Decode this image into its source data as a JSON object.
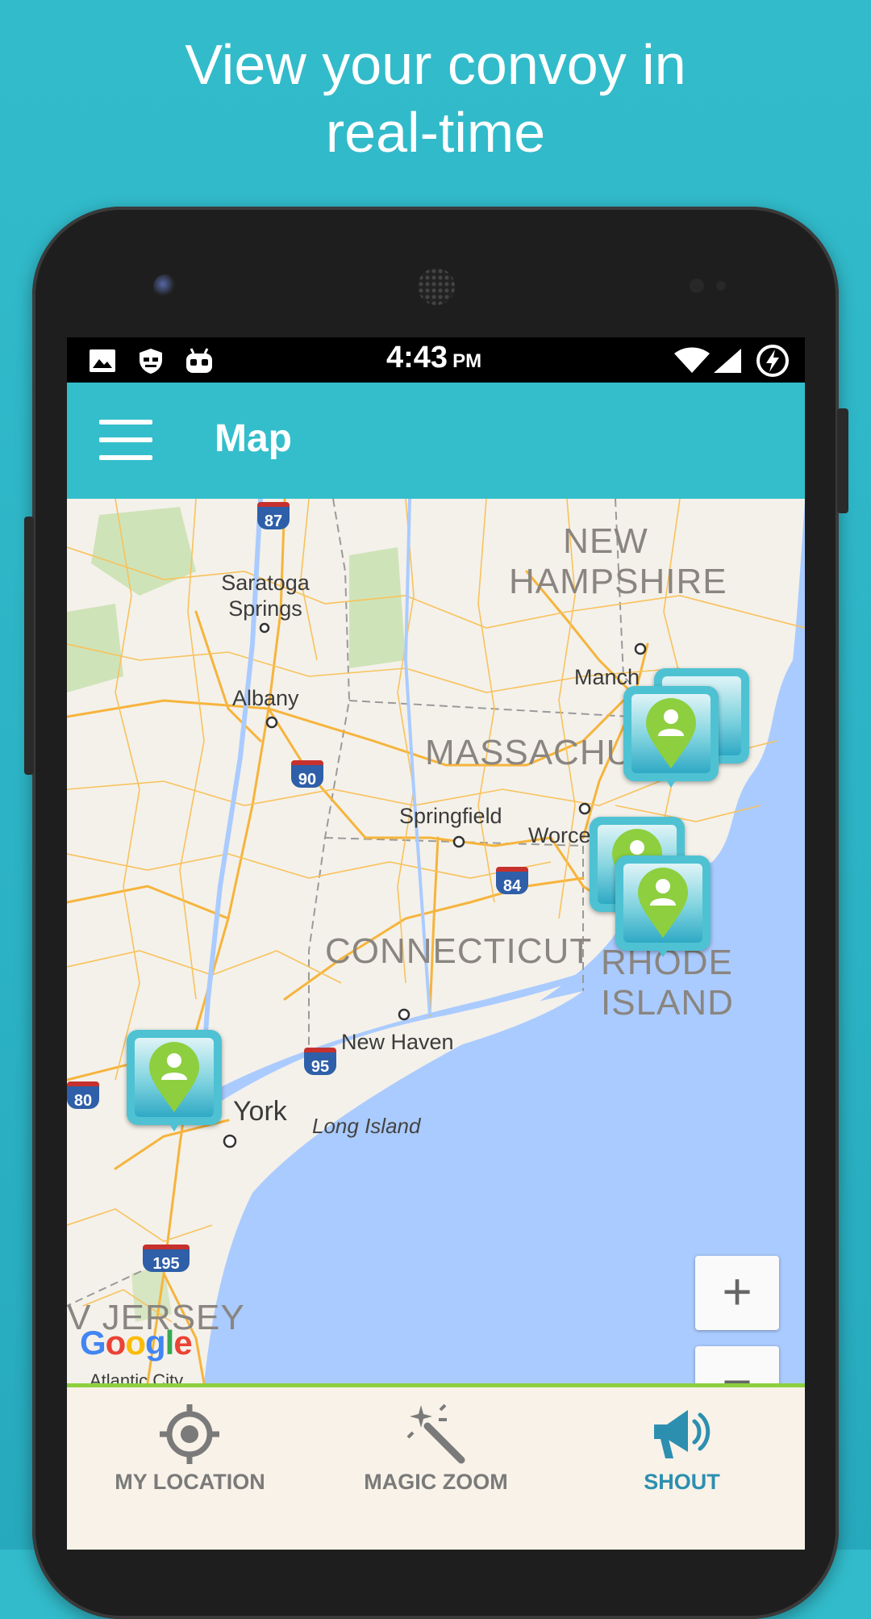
{
  "headline": {
    "line1": "View your convoy in",
    "line2": "real-time"
  },
  "status_bar": {
    "time": "4:43",
    "ampm": "PM",
    "left_icons": [
      "image-icon",
      "incognito-icon",
      "android-robot-icon"
    ],
    "right_icons": [
      "wifi-icon",
      "cell-signal-icon",
      "battery-charging-icon"
    ]
  },
  "app_bar": {
    "menu_icon": "hamburger-icon",
    "title": "Map"
  },
  "map": {
    "states": [
      "NEW HAMPSHIRE",
      "MASSACHU",
      "CONNECTICUT",
      "RHODE ISLAND",
      "V JERSEY"
    ],
    "cities": [
      "Saratoga Springs",
      "Albany",
      "Manch",
      "Springfield",
      "Worce",
      "New Haven",
      "York",
      "Long Island",
      "Atlantic City"
    ],
    "highway_shields": [
      "87",
      "90",
      "84",
      "95",
      "80",
      "195"
    ],
    "attribution": "Google",
    "zoom_in_label": "+",
    "zoom_out_label": "−",
    "markers_count": 5,
    "colors": {
      "land": "#F4F1EA",
      "water": "#AACBFF",
      "roads": "#F6B43C",
      "marker_frame": "#4EC2D3",
      "marker_pin": "#8DCF3F"
    }
  },
  "bottom_nav": {
    "tabs": [
      {
        "label": "MY LOCATION",
        "icon": "target-icon"
      },
      {
        "label": "MAGIC ZOOM",
        "icon": "magic-wand-icon"
      },
      {
        "label": "SHOUT",
        "icon": "megaphone-icon"
      }
    ],
    "active_tab": "SHOUT",
    "accent": "#2C8FB0"
  }
}
